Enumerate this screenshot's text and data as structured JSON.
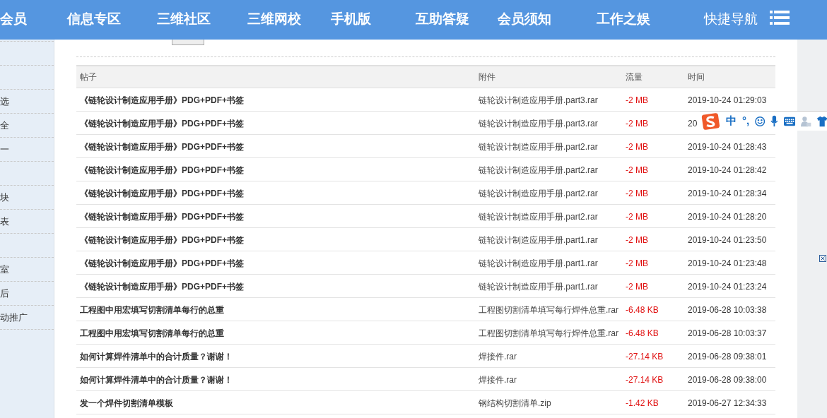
{
  "nav": {
    "items": [
      {
        "label": "会员",
        "bold": true
      },
      {
        "label": "信息专区",
        "bold": true
      },
      {
        "label": "三维社区",
        "bold": true
      },
      {
        "label": "三维网校",
        "bold": true
      },
      {
        "label": "手机版",
        "bold": true
      },
      {
        "label": "互助答疑",
        "bold": true
      },
      {
        "label": "会员须知",
        "bold": true
      },
      {
        "label": "工作之娱",
        "bold": true
      },
      {
        "label": "快捷导航",
        "bold": false
      }
    ]
  },
  "sidebar": {
    "items": [
      {
        "kind": "blank"
      },
      {
        "kind": "blank"
      },
      {
        "kind": "blank"
      },
      {
        "kind": "text",
        "label": "选"
      },
      {
        "kind": "text",
        "label": "全"
      },
      {
        "kind": "text",
        "label": "一"
      },
      {
        "kind": "blank"
      },
      {
        "kind": "text",
        "label": "块"
      },
      {
        "kind": "text",
        "label": "表"
      },
      {
        "kind": "blank"
      },
      {
        "kind": "text",
        "label": "室"
      },
      {
        "kind": "text",
        "label": "后"
      },
      {
        "kind": "text",
        "label": "动推广"
      }
    ]
  },
  "table": {
    "columns": [
      "帖子",
      "附件",
      "流量",
      "时间"
    ],
    "rows": [
      [
        "《链轮设计制造应用手册》PDG+PDF+书签",
        "链轮设计制造应用手册.part3.rar",
        "-2 MB",
        "2019-10-24 01:29:03"
      ],
      [
        "《链轮设计制造应用手册》PDG+PDF+书签",
        "链轮设计制造应用手册.part3.rar",
        "-2 MB",
        "20"
      ],
      [
        "《链轮设计制造应用手册》PDG+PDF+书签",
        "链轮设计制造应用手册.part2.rar",
        "-2 MB",
        "2019-10-24 01:28:43"
      ],
      [
        "《链轮设计制造应用手册》PDG+PDF+书签",
        "链轮设计制造应用手册.part2.rar",
        "-2 MB",
        "2019-10-24 01:28:42"
      ],
      [
        "《链轮设计制造应用手册》PDG+PDF+书签",
        "链轮设计制造应用手册.part2.rar",
        "-2 MB",
        "2019-10-24 01:28:34"
      ],
      [
        "《链轮设计制造应用手册》PDG+PDF+书签",
        "链轮设计制造应用手册.part2.rar",
        "-2 MB",
        "2019-10-24 01:28:20"
      ],
      [
        "《链轮设计制造应用手册》PDG+PDF+书签",
        "链轮设计制造应用手册.part1.rar",
        "-2 MB",
        "2019-10-24 01:23:50"
      ],
      [
        "《链轮设计制造应用手册》PDG+PDF+书签",
        "链轮设计制造应用手册.part1.rar",
        "-2 MB",
        "2019-10-24 01:23:48"
      ],
      [
        "《链轮设计制造应用手册》PDG+PDF+书签",
        "链轮设计制造应用手册.part1.rar",
        "-2 MB",
        "2019-10-24 01:23:24"
      ],
      [
        "工程图中用宏填写切割清单每行的总重",
        "工程图切割清单填写每行焊件总重.rar",
        "-6.48 KB",
        "2019-06-28 10:03:38"
      ],
      [
        "工程图中用宏填写切割清单每行的总重",
        "工程图切割清单填写每行焊件总重.rar",
        "-6.48 KB",
        "2019-06-28 10:03:37"
      ],
      [
        "如何计算焊件清单中的合计质量？谢谢！",
        "焊接件.rar",
        "-27.14 KB",
        "2019-06-28 09:38:01"
      ],
      [
        "如何计算焊件清单中的合计质量？谢谢！",
        "焊接件.rar",
        "-27.14 KB",
        "2019-06-28 09:38:00"
      ],
      [
        "发一个焊件切割清单模板",
        "钢结构切割清单.zip",
        "-1.42 KB",
        "2019-06-27 12:34:33"
      ]
    ]
  },
  "ime": {
    "mode": "中",
    "punct": "°,"
  }
}
